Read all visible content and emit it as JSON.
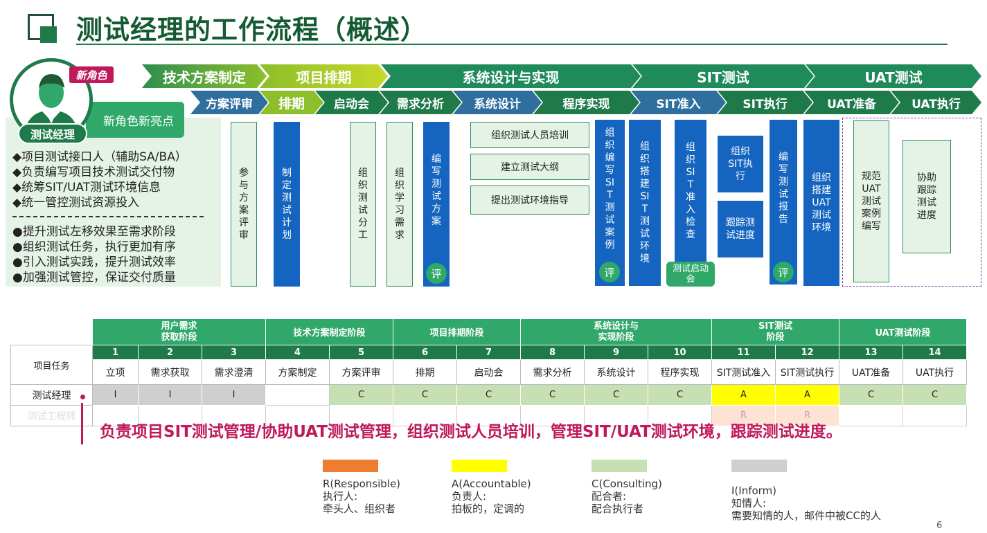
{
  "title": "测试经理的工作流程（概述）",
  "colors": {
    "dark_green": "#1f7a4a",
    "green": "#2fa86a",
    "olive": "#8cbf2a",
    "blue": "#2e6f9e",
    "teal": "#1f8a6a",
    "magenta": "#c0185a"
  },
  "phases": [
    "技术方案制定",
    "项目排期",
    "系统设计与实现",
    "SIT测试",
    "UAT测试"
  ],
  "subphases": [
    "方案评审",
    "排期",
    "启动会",
    "需求分析",
    "系统设计",
    "程序实现",
    "SIT准入",
    "SIT执行",
    "UAT准备",
    "UAT执行"
  ],
  "role": {
    "badge": "新角色",
    "name": "测试经理",
    "highlight": "新角色新亮点",
    "icon": "person-icon"
  },
  "responsibilities": [
    "◆项目测试接口人（辅助SA/BA）",
    "◆负责编写项目技术测试交付物",
    "◆统筹SIT/UAT测试环境信息",
    "◆统一管控测试资源投入"
  ],
  "separator": "--------------------------------",
  "improvements": [
    "●提升测试左移效果至需求阶段",
    "●组织测试任务，执行更加有序",
    "●引入测试实践，提升测试效率",
    "●加强测试管控，保证交付质量"
  ],
  "tasks": {
    "t1": "参与方案评审",
    "t2": "制定测试计划",
    "t3": "组织测试分工",
    "t4": "组织学习需求",
    "t5": "编写测试方案",
    "h1": "组织测试人员培训",
    "h2": "建立测试大纲",
    "h3": "提出测试环境指导",
    "t6": "组织编写SIT测试案例",
    "t7": "组织搭建SIT测试环境",
    "t8": "组织SIT准入检查",
    "t8b": "测试启动会",
    "t9": "组织SIT执行",
    "t10": "跟踪测试进度",
    "t11": "编写测试报告",
    "t12": "组织搭建UAT测试环境",
    "t13": "规范UAT测试案例编写",
    "t14": "协助跟踪测试进度",
    "review": "评"
  },
  "table": {
    "group_headers": [
      "用户需求\n获取阶段",
      "技术方案制定阶段",
      "项目排期阶段",
      "系统设计与\n实现阶段",
      "SIT测试\n阶段",
      "UAT测试阶段"
    ],
    "numbers": [
      "1",
      "2",
      "3",
      "4",
      "5",
      "6",
      "7",
      "8",
      "9",
      "10",
      "11",
      "12",
      "13",
      "14"
    ],
    "row_label": "项目任务",
    "tasks": [
      "立项",
      "需求获取",
      "需求澄清",
      "方案制定",
      "方案评审",
      "排期",
      "启动会",
      "需求分析",
      "系统设计",
      "程序实现",
      "SIT测试准入",
      "SIT测试执行",
      "UAT准备",
      "UAT执行"
    ],
    "row1_label": "测试经理",
    "row1": [
      "I",
      "I",
      "I",
      "",
      "C",
      "C",
      "C",
      "C",
      "C",
      "C",
      "A",
      "A",
      "C",
      "C"
    ],
    "row2_label": "测试工程师",
    "row2": [
      "",
      "",
      "",
      "",
      "",
      "",
      "",
      "",
      "",
      "",
      "R",
      "R",
      "",
      ""
    ]
  },
  "summary": "负责项目SIT测试管理/协助UAT测试管理，组织测试人员培训，管理SIT/UAT测试环境，跟踪测试进度。",
  "legend": [
    {
      "code": "R(Responsible)",
      "title": "执行人:",
      "desc": "牵头人、组织者",
      "color": "#ed7d31"
    },
    {
      "code": "A(Accountable)",
      "title": "负责人:",
      "desc": "拍板的，定调的",
      "color": "#ffff00"
    },
    {
      "code": "C(Consulting)",
      "title": "配合者:",
      "desc": "配合执行者",
      "color": "#c6e0b4"
    },
    {
      "code": "I(Inform)",
      "title": "知情人:",
      "desc": "需要知情的人，邮件中被CC的人",
      "color": "#cfcfcf"
    }
  ],
  "page_number": "6"
}
